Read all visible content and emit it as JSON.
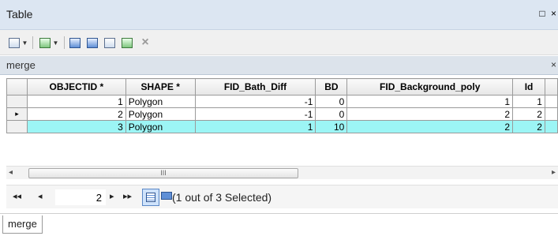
{
  "window": {
    "title": "Table",
    "controls": "□ ×"
  },
  "toolbar": {
    "items": [
      "table-options-icon",
      "related-tables-icon",
      "select-by-attributes-icon",
      "switch-selection-icon",
      "clear-selection-icon",
      "zoom-to-selected-icon",
      "delete-selected-icon"
    ]
  },
  "table_tab": {
    "name": "merge",
    "close": "×"
  },
  "grid": {
    "columns": [
      "OBJECTID *",
      "SHAPE *",
      "FID_Bath_Diff",
      "BD",
      "FID_Background_poly",
      "Id"
    ],
    "rows": [
      {
        "marker": "",
        "cells": [
          "1",
          "Polygon",
          "-1",
          "0",
          "1",
          "1"
        ],
        "selected": false
      },
      {
        "marker": "▸",
        "cells": [
          "2",
          "Polygon",
          "-1",
          "0",
          "2",
          "2"
        ],
        "selected": false
      },
      {
        "marker": "",
        "cells": [
          "3",
          "Polygon",
          "1",
          "10",
          "2",
          "2"
        ],
        "selected": true
      }
    ]
  },
  "scrollbar": {
    "left": "◂",
    "right": "▸",
    "grip": "III"
  },
  "navigator": {
    "first": "◂◂",
    "prev": "◂",
    "current_record": "2",
    "next": "▸",
    "last": "▸▸",
    "selection_text": "(1 out of 3 Selected)"
  },
  "bottom_tabs": [
    "merge"
  ],
  "colors": {
    "selected_row": "#9cf5f5",
    "title_bg": "#dce6f2"
  }
}
